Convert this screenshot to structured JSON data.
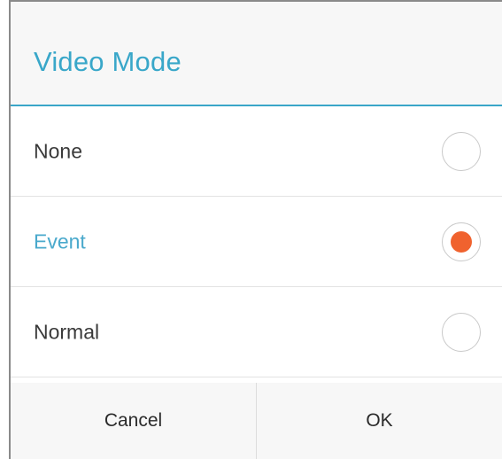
{
  "dialog": {
    "title": "Video Mode",
    "options": [
      {
        "label": "None",
        "selected": false
      },
      {
        "label": "Event",
        "selected": true
      },
      {
        "label": "Normal",
        "selected": false
      }
    ],
    "cancel_label": "Cancel",
    "ok_label": "OK"
  },
  "colors": {
    "title": "#39a7c9",
    "selected_label": "#4aa9cc",
    "radio_selected": "#f0622e",
    "header_background": "#f7f7f7"
  }
}
